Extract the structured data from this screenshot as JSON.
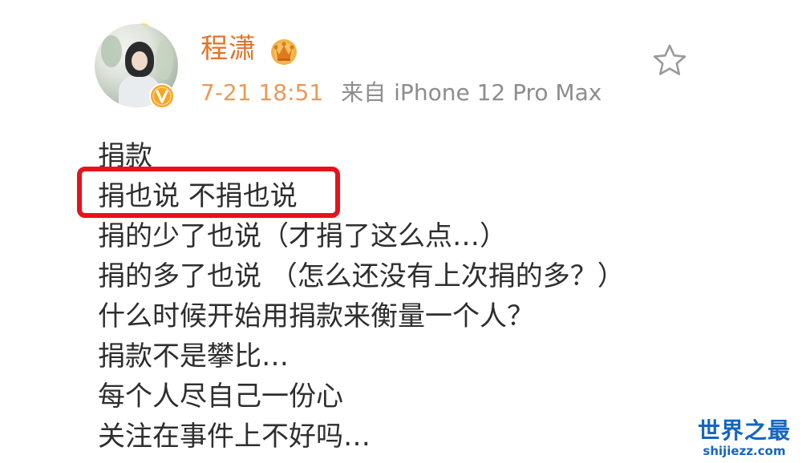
{
  "post": {
    "author": {
      "name": "程潇",
      "avatar_icon": "avatar-photo",
      "verified_icon": "verified-v-badge",
      "vip_icon": "crown-vip-icon"
    },
    "timestamp": "7-21 18:51",
    "source_prefix": "来自",
    "source_device": "iPhone 12 Pro Max",
    "favorite_icon": "star-outline-icon",
    "lines": [
      "捐款",
      "捐也说 不捐也说",
      "捐的少了也说（才捐了这么点…）",
      "捐的多了也说 （怎么还没有上次捐的多？）",
      "什么时候开始用捐款来衡量一个人？",
      "捐款不是攀比…",
      "每个人尽自己一份心",
      "关注在事件上不好吗…"
    ],
    "highlighted_line_index": 1
  },
  "watermark": {
    "title": "世界之最",
    "url": "shijiezz.com"
  },
  "colors": {
    "username": "#e0742b",
    "timestamp": "#ea9a58",
    "meta": "#8d8d8d",
    "body_text": "#2e2e2e",
    "highlight_border": "#e8121a",
    "watermark": "#1565c0",
    "verified_badge": "#f5a623"
  }
}
